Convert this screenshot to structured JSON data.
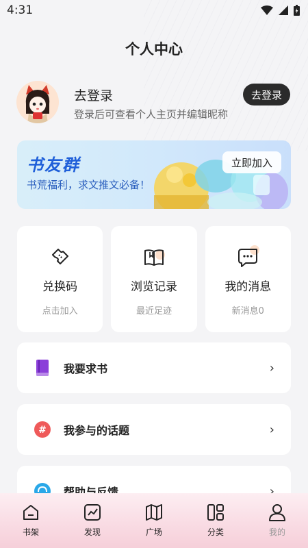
{
  "status": {
    "time": "4:31"
  },
  "header": {
    "title": "个人中心"
  },
  "profile": {
    "title": "去登录",
    "subtitle": "登录后可查看个人主页并编辑昵称",
    "button": "去登录"
  },
  "banner": {
    "title": "书友群",
    "subtitle": "书荒福利，求文推文必备！",
    "button": "立即加入"
  },
  "cards": [
    {
      "title": "兑换码",
      "sub": "点击加入",
      "icon": "ticket-icon"
    },
    {
      "title": "浏览记录",
      "sub": "最近足迹",
      "icon": "book-icon"
    },
    {
      "title": "我的消息",
      "sub": "新消息0",
      "icon": "message-icon"
    }
  ],
  "list": [
    {
      "label": "我要求书",
      "icon": "book-request-icon",
      "color": "#8b3fd9"
    },
    {
      "label": "我参与的话题",
      "icon": "hashtag-icon",
      "color": "#ef5a5a"
    },
    {
      "label": "帮助与反馈",
      "icon": "help-icon",
      "color": "#2aa8e8"
    }
  ],
  "tabs": [
    {
      "label": "书架",
      "icon": "bookshelf-icon"
    },
    {
      "label": "发现",
      "icon": "discover-icon"
    },
    {
      "label": "广场",
      "icon": "map-icon"
    },
    {
      "label": "分类",
      "icon": "category-icon"
    },
    {
      "label": "我的",
      "icon": "user-icon"
    }
  ]
}
